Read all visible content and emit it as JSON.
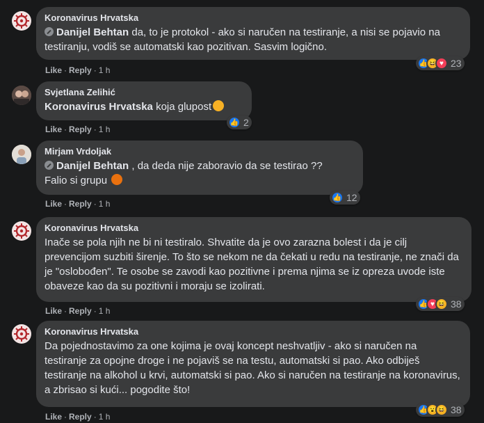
{
  "comments": [
    {
      "author": "Koronavirus Hrvatska",
      "mention": "Danijel Behtan",
      "text_after_mention": " da, to je protokol - ako si naručen na testiranje, a nisi se pojavio na testiranju, vodiš se automatski kao pozitivan. Sasvim logično.",
      "like": "Like",
      "reply": "Reply",
      "time": "1 h",
      "reaction_count": "23",
      "reactions": [
        "like-icon",
        "haha-icon",
        "love-icon"
      ]
    },
    {
      "author": "Svjetlana Zelihić",
      "mention": "Koronavirus Hrvatska",
      "text_after_mention": " koja glupost",
      "like": "Like",
      "reply": "Reply",
      "time": "1 h",
      "reaction_count": "2",
      "reactions": [
        "like-icon"
      ]
    },
    {
      "author": "Mirjam Vrdoljak",
      "mention": "Danijel Behtan",
      "text_after_mention": " , da deda nije zaboravio da se testirao ??",
      "text_line2": "Falio si grupu",
      "like": "Like",
      "reply": "Reply",
      "time": "1 h",
      "reaction_count": "12",
      "reactions": [
        "like-icon"
      ]
    },
    {
      "author": "Koronavirus Hrvatska",
      "text": "Inače se pola njih ne bi ni testiralo. Shvatite da je ovo zarazna bolest i da je cilj prevencijom suzbiti širenje. To što se nekom ne da čekati u redu na testiranje, ne znači da je \"oslobođen\". Te osobe se zavodi kao pozitivne i prema njima se iz opreza uvode iste obaveze kao da su pozitivni i moraju se izolirati.",
      "like": "Like",
      "reply": "Reply",
      "time": "1 h",
      "reaction_count": "38",
      "reactions": [
        "like-icon",
        "love-icon",
        "haha-icon"
      ]
    },
    {
      "author": "Koronavirus Hrvatska",
      "text": "Da pojednostavimo za one kojima je ovaj koncept neshvatljiv - ako si naručen na testiranje za opojne droge i ne pojaviš se na testu, automatski si pao. Ako odbiješ testiranje na alkohol u krvi, automatski si pao. Ako si naručen na testiranje na koronavirus, a zbrisao si kući... pogodite što!",
      "like": "Like",
      "reply": "Reply",
      "time": "1 h",
      "reaction_count": "38",
      "reactions": [
        "like-icon",
        "wow-icon",
        "haha-icon"
      ]
    }
  ],
  "separator": "·",
  "colors": {
    "background": "#18191a",
    "bubble": "#3a3b3c",
    "text": "#e4e6eb",
    "secondary_text": "#b0b3b8",
    "like_blue": "#1877f2",
    "love_red": "#f33e58",
    "haha_yellow": "#f7b125"
  }
}
